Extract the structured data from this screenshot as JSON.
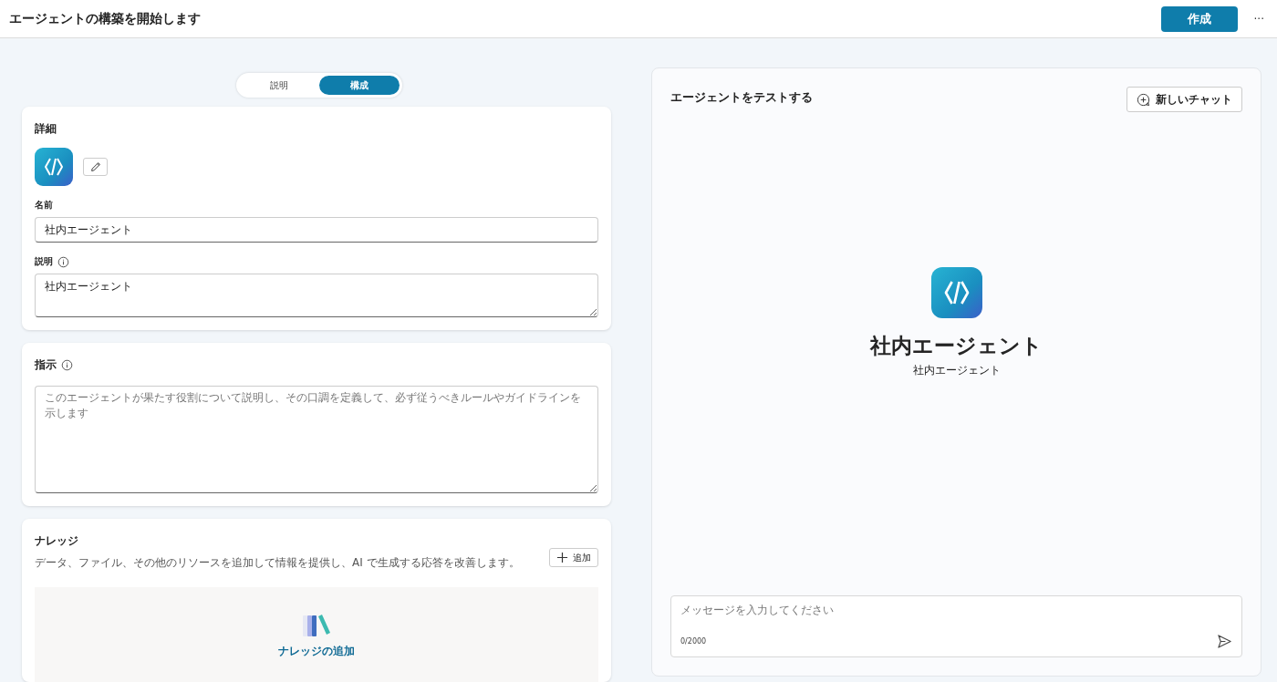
{
  "header": {
    "title": "エージェントの構築を開始します",
    "create_button": "作成",
    "more_button": "···"
  },
  "tabs": [
    {
      "label": "説明",
      "selected": false
    },
    {
      "label": "構成",
      "selected": true
    }
  ],
  "details": {
    "heading": "詳細",
    "name_label": "名前",
    "name_value": "社内エージェント",
    "description_label": "説明",
    "description_value": "社内エージェント"
  },
  "instructions": {
    "heading": "指示",
    "placeholder": "このエージェントが果たす役割について説明し、その口調を定義して、必ず従うべきルールやガイドラインを示します"
  },
  "knowledge": {
    "heading": "ナレッジ",
    "description": "データ、ファイル、その他のリソースを追加して情報を提供し、AI で生成する応答を改善します。",
    "add_button": "追加",
    "add_knowledge_label": "ナレッジの追加"
  },
  "test_panel": {
    "heading": "エージェントをテストする",
    "new_chat_button": "新しいチャット",
    "agent_name": "社内エージェント",
    "agent_description": "社内エージェント",
    "message_placeholder": "メッセージを入力してください",
    "char_count": "0/2000"
  }
}
